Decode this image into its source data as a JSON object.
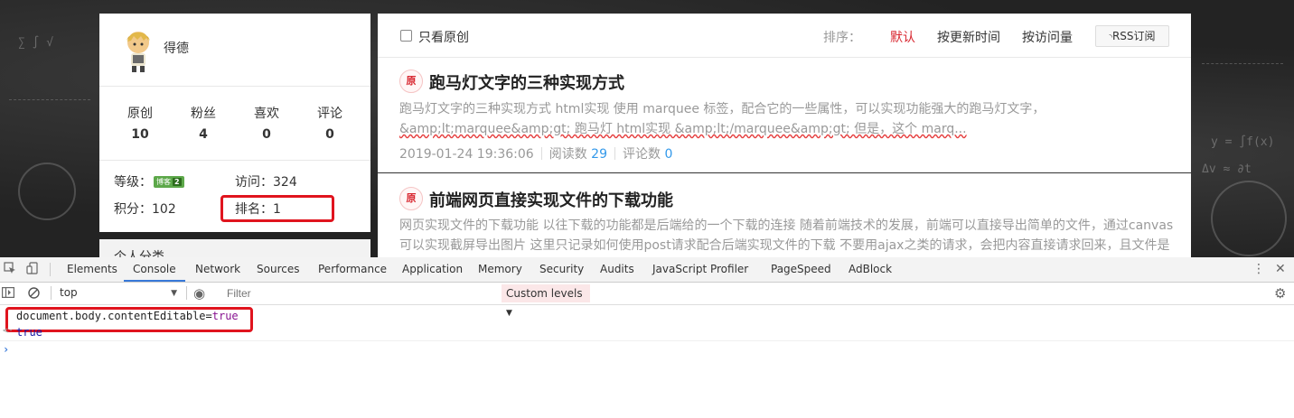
{
  "profile": {
    "name": "得德",
    "stats": [
      {
        "label": "原创",
        "value": "10"
      },
      {
        "label": "粉丝",
        "value": "4"
      },
      {
        "label": "喜欢",
        "value": "0"
      },
      {
        "label": "评论",
        "value": "0"
      }
    ],
    "level_label": "等级：",
    "level_badge": "博客",
    "level_number": "2",
    "visits_label": "访问：",
    "visits_value": "324",
    "points_label": "积分：",
    "points_value": "102",
    "rank_label": "排名：",
    "rank_value": "1",
    "next_section": "个人分类"
  },
  "toolbar": {
    "only_original": "只看原创",
    "sort_label": "排序：",
    "sort_default": "默认",
    "sort_updated": "按更新时间",
    "sort_views": "按访问量",
    "rss": "RSS订阅"
  },
  "articles": [
    {
      "badge": "原",
      "title": "跑马灯文字的三种实现方式",
      "desc_1": "跑马灯文字的三种实现方式 html实现 使用 marquee 标签，配合它的一些属性，可以实现功能强大的跑马灯文字，",
      "desc_2": "&amp;lt;marquee&amp;gt; 跑马灯 html实现 &amp;lt;/marquee&amp;gt; 但是，这个 marq...",
      "date": "2019-01-24 19:36:06",
      "reads_label": "阅读数",
      "reads": "29",
      "comments_label": "评论数",
      "comments": "0"
    },
    {
      "badge": "原",
      "title": "前端网页直接实现文件的下载功能",
      "desc_1": "网页实现文件的下载功能 以往下载的功能都是后端给的一个下载的连接 随着前端技术的发展，前端可以直接导出简单的文件，通过canvas",
      "desc_2": "可以实现截屏导出图片 这里只记录如何使用post请求配合后端实现文件的下载 不要用ajax之类的请求，会把内容直接请求回来，且文件是"
    }
  ],
  "devtools": {
    "tabs": [
      "Elements",
      "Console",
      "Network",
      "Sources",
      "Performance",
      "Application",
      "Memory",
      "Security",
      "Audits",
      "JavaScript Profiler",
      "PageSpeed",
      "AdBlock"
    ],
    "active_tab": "Console",
    "context": "top",
    "filter_placeholder": "Filter",
    "levels": "Custom levels",
    "command_code": "document.body.contentEditable=",
    "command_value": "true",
    "result": "true",
    "accent": "#3879d9"
  },
  "colors": {
    "highlight": "#e0141e",
    "sort_active": "#d8262f",
    "link": "#3399ea"
  }
}
